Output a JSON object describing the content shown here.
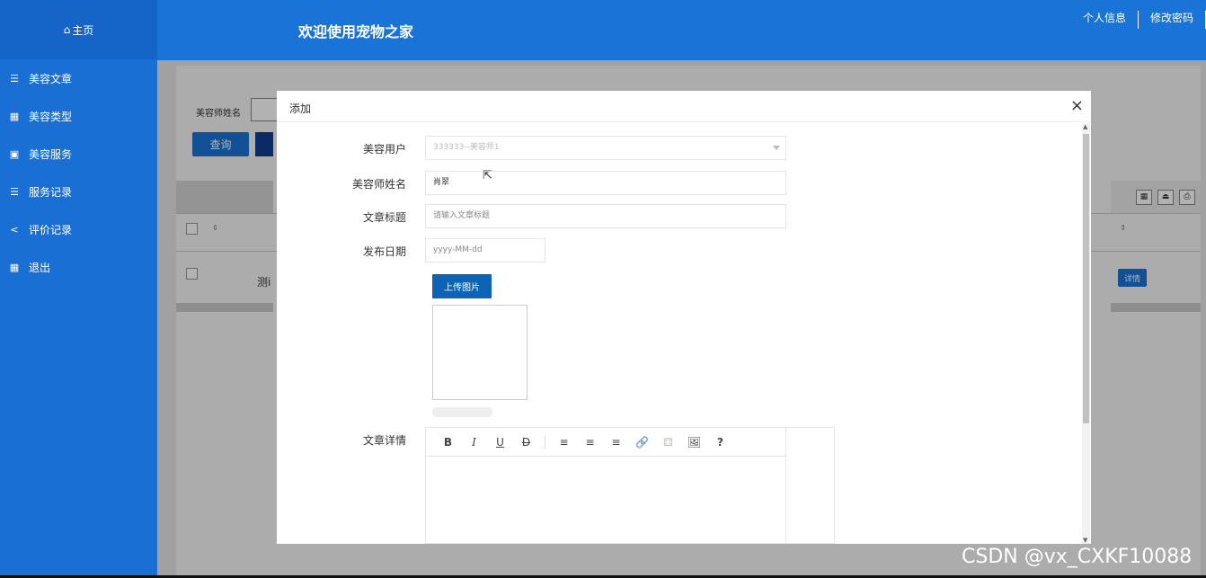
{
  "sidebar": {
    "home": "主页",
    "items": [
      {
        "label": "美容文章",
        "icon": "list-icon"
      },
      {
        "label": "美容类型",
        "icon": "grid-icon"
      },
      {
        "label": "美容服务",
        "icon": "bookmark-icon"
      },
      {
        "label": "服务记录",
        "icon": "list-icon"
      },
      {
        "label": "评价记录",
        "icon": "share-icon"
      },
      {
        "label": "退出",
        "icon": "grid-icon"
      }
    ]
  },
  "header": {
    "title": "欢迎使用宠物之家",
    "links": [
      "个人信息",
      "修改密码"
    ]
  },
  "background": {
    "search_label": "美容师姓名",
    "query_button": "查询",
    "row_text": "测i",
    "detail_button": "详情"
  },
  "modal": {
    "title": "添加",
    "close": "×",
    "fields": {
      "user_label": "美容用户",
      "user_value": "333333--美容师1",
      "name_label": "美容师姓名",
      "name_value": "肖翠",
      "article_title_label": "文章标题",
      "article_title_placeholder": "请输入文章标题",
      "date_label": "发布日期",
      "date_placeholder": "yyyy-MM-dd",
      "upload_button": "上传图片",
      "detail_label": "文章详情"
    },
    "toolbar": [
      "B",
      "I",
      "U",
      "D",
      "≡",
      "≡",
      "≡",
      "🔗",
      "⚃",
      "🖼",
      "?"
    ]
  },
  "watermark": "CSDN @vx_CXKF10088"
}
